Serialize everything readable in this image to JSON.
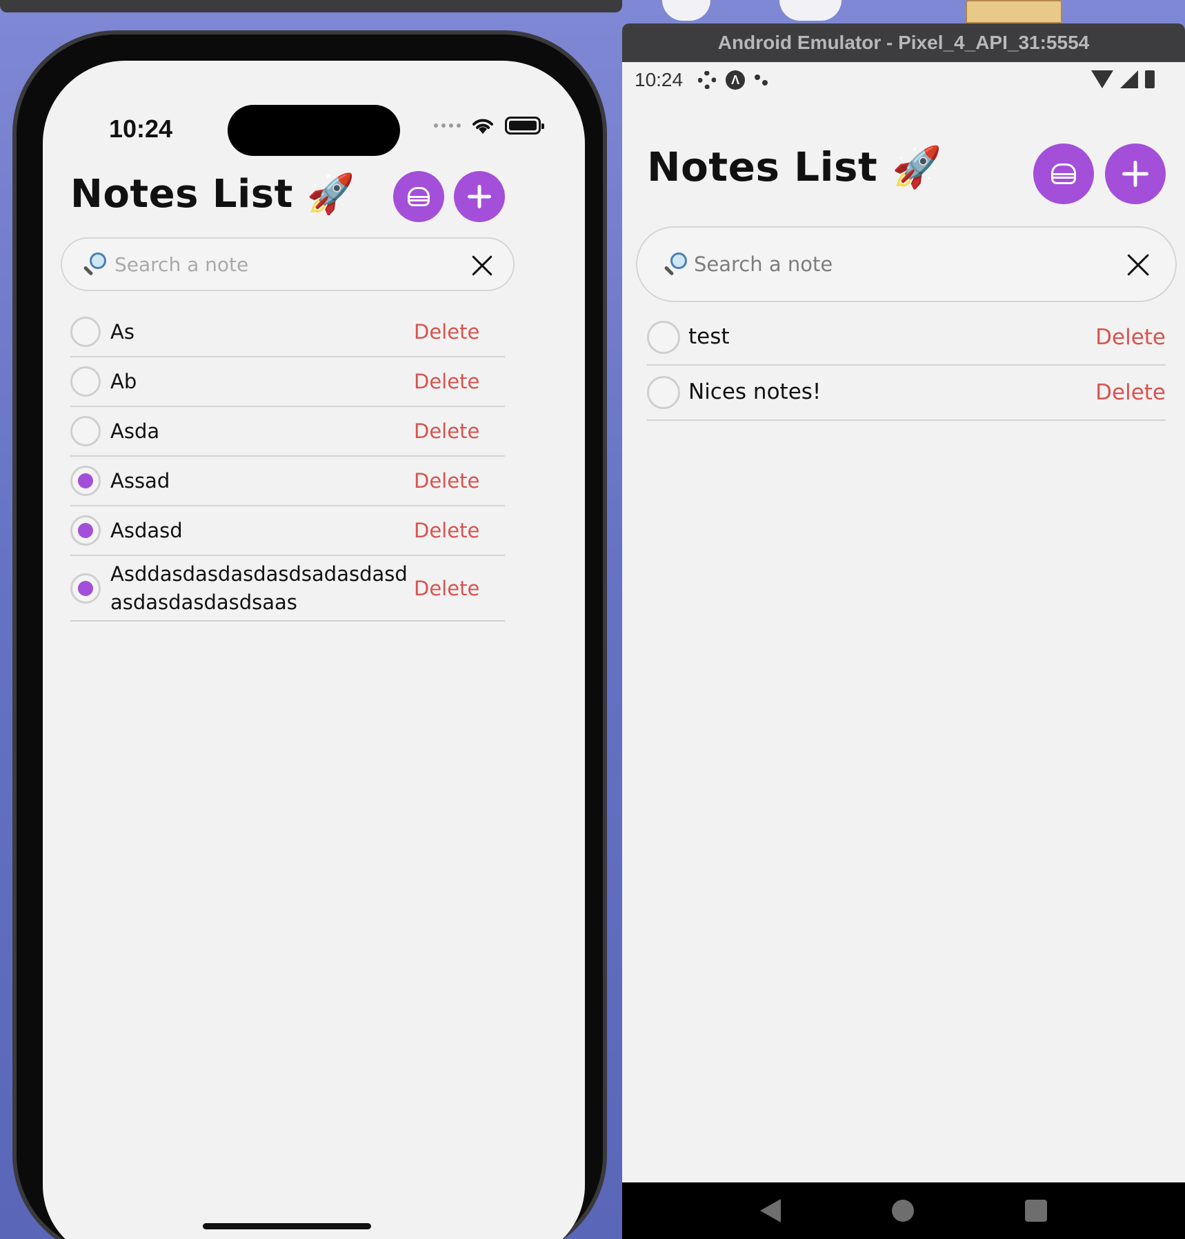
{
  "desktop": {
    "colors": {
      "wallpaper": "#6d79c6",
      "accent": "#a34fd9",
      "delete": "#d9534f"
    }
  },
  "ios": {
    "status": {
      "time": "10:24"
    },
    "app": {
      "title": "Notes List 🚀",
      "search": {
        "placeholder": "Search a note",
        "icon": "search-icon"
      },
      "buttons": {
        "menu_icon": "burger-icon",
        "add_icon": "plus-icon"
      },
      "notes": [
        {
          "text": "As",
          "checked": false,
          "delete_label": "Delete"
        },
        {
          "text": "Ab",
          "checked": false,
          "delete_label": "Delete"
        },
        {
          "text": "Asda",
          "checked": false,
          "delete_label": "Delete"
        },
        {
          "text": "Assad",
          "checked": true,
          "delete_label": "Delete"
        },
        {
          "text": "Asdasd",
          "checked": true,
          "delete_label": "Delete"
        },
        {
          "text": "Asddasdasdasdasdsadasdasdasdasdasdasdsaas",
          "checked": true,
          "delete_label": "Delete"
        }
      ]
    }
  },
  "android": {
    "window_title": "Android Emulator - Pixel_4_API_31:5554",
    "status": {
      "time": "10:24"
    },
    "app": {
      "title": "Notes List 🚀",
      "search": {
        "placeholder": "Search a note",
        "icon": "search-icon"
      },
      "buttons": {
        "menu_icon": "burger-icon",
        "add_icon": "plus-icon"
      },
      "notes": [
        {
          "text": "test",
          "checked": false,
          "delete_label": "Delete"
        },
        {
          "text": "Nices notes!",
          "checked": false,
          "delete_label": "Delete"
        }
      ]
    }
  }
}
